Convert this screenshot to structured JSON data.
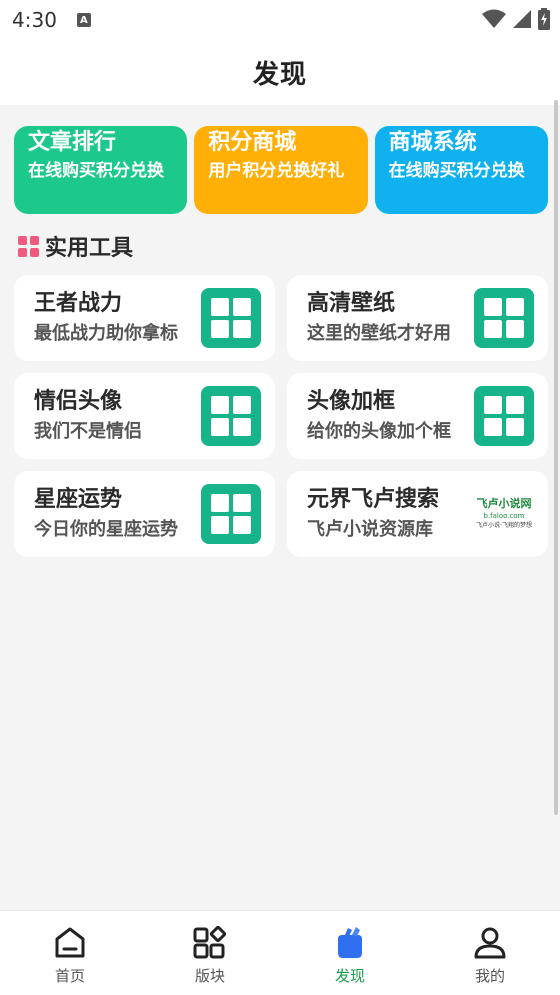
{
  "status_bar": {
    "time": "4:30",
    "notification_icon": "A"
  },
  "header": {
    "title": "发现"
  },
  "promos": [
    {
      "title": "文章排行",
      "subtitle": "在线购买积分兑换",
      "color": "#1dc98a"
    },
    {
      "title": "积分商城",
      "subtitle": "用户积分兑换好礼",
      "color": "#ffaf06"
    },
    {
      "title": "商城系统",
      "subtitle": "在线购买积分兑换",
      "color": "#0fb2ee"
    }
  ],
  "section": {
    "title": "实用工具",
    "icon": "grid-icon",
    "icon_color": "#f05a7e"
  },
  "tools": [
    {
      "title": "王者战力",
      "subtitle": "最低战力助你拿标",
      "icon": "grid-app-icon"
    },
    {
      "title": "高清壁纸",
      "subtitle": "这里的壁纸才好用",
      "icon": "grid-app-icon"
    },
    {
      "title": "情侣头像",
      "subtitle": "我们不是情侣",
      "icon": "grid-app-icon"
    },
    {
      "title": "头像加框",
      "subtitle": "给你的头像加个框",
      "icon": "grid-app-icon"
    },
    {
      "title": "星座运势",
      "subtitle": "今日你的星座运势",
      "icon": "grid-app-icon"
    },
    {
      "title": "元界飞卢搜索",
      "subtitle": "飞卢小说资源库",
      "icon": "faloo-logo-icon",
      "logo_text": "飞卢小说网",
      "logo_url": "b.faloo.com",
      "logo_tagline": "飞卢小说·飞翔的梦想"
    }
  ],
  "accent_color": "#17b38a",
  "bottom_nav": [
    {
      "label": "首页",
      "icon": "home-icon",
      "active": false
    },
    {
      "label": "版块",
      "icon": "blocks-icon",
      "active": false
    },
    {
      "label": "发现",
      "icon": "discover-icon",
      "active": true
    },
    {
      "label": "我的",
      "icon": "profile-icon",
      "active": false
    }
  ]
}
